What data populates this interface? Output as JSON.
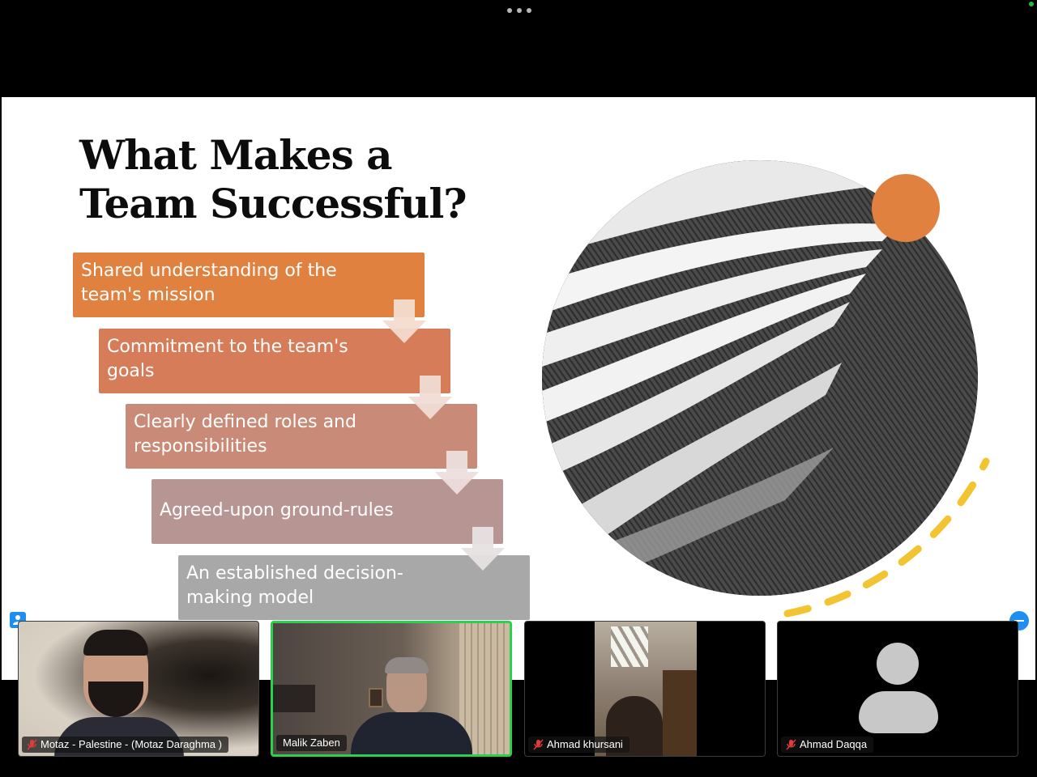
{
  "slide": {
    "title_line1": "What Makes a",
    "title_line2": "Team Successful?",
    "steps": [
      {
        "text": "Shared understanding of the team's mission",
        "color": "#e08140"
      },
      {
        "text": "Commitment to the team's goals",
        "color": "#d67c58"
      },
      {
        "text": "Clearly defined roles and responsibilities",
        "color": "#c98b78"
      },
      {
        "text": "Agreed-upon ground-rules",
        "color": "#b79593"
      },
      {
        "text": "An established decision-making model",
        "color": "#a8a8a8"
      }
    ],
    "accent_colors": {
      "orange": "#e08140",
      "yellow": "#f3c431"
    }
  },
  "participants": [
    {
      "name": "Motaz - Palestine - (Motaz Daraghma )",
      "muted": true,
      "video": "on"
    },
    {
      "name": "Malik Zaben",
      "muted": false,
      "video": "on",
      "active_speaker": true
    },
    {
      "name": "Ahmad khursani",
      "muted": true,
      "video": "on"
    },
    {
      "name": "Ahmad Daqqa",
      "muted": true,
      "video": "off"
    }
  ],
  "icons": {
    "toolbar_more": "more-dots-icon",
    "gallery": "gallery-view-icon",
    "collapse": "minimize-icon",
    "muted_mic": "muted-mic-icon",
    "avatar_placeholder": "user-placeholder-icon"
  }
}
